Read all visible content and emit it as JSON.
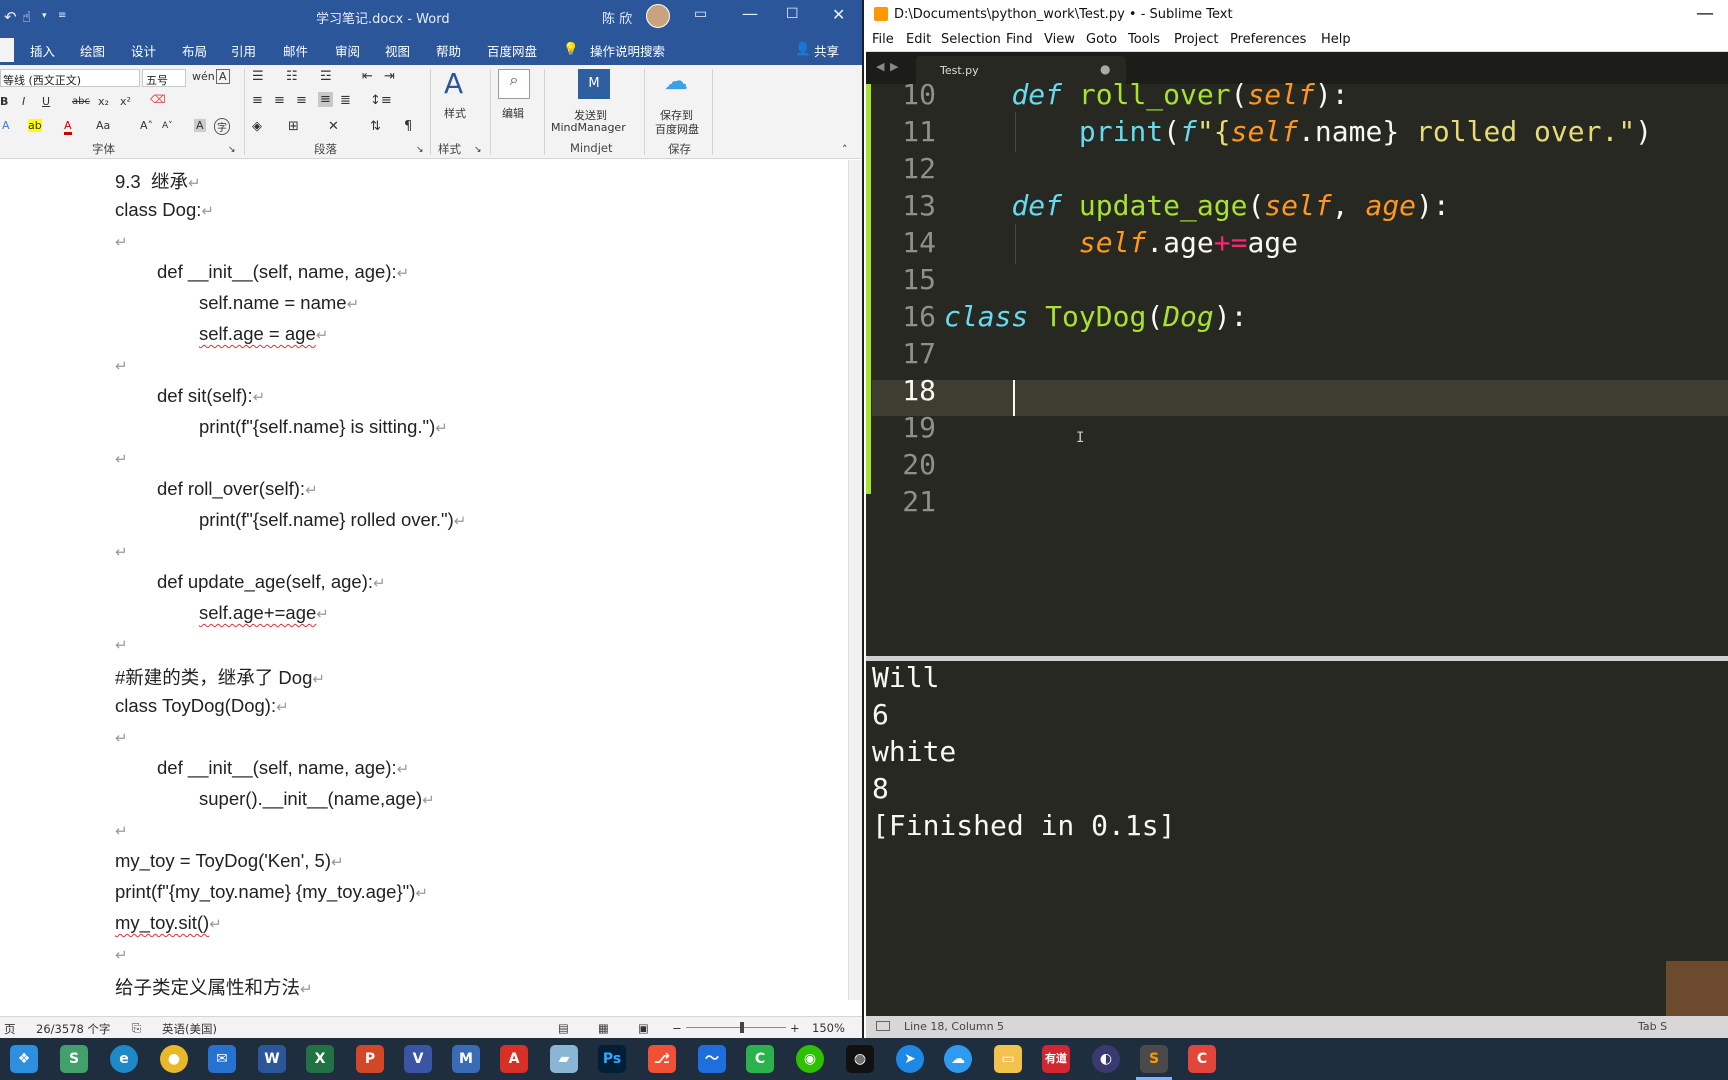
{
  "word": {
    "title_file": "学习笔记.docx",
    "title_app": "Word",
    "user_name": "陈 欣",
    "tabs": [
      "插入",
      "绘图",
      "设计",
      "布局",
      "引用",
      "邮件",
      "审阅",
      "视图",
      "帮助",
      "百度网盘",
      "操作说明搜索"
    ],
    "share_label": "共享",
    "font_name": "等线 (西文正文)",
    "font_size": "五号",
    "groups": {
      "font": "字体",
      "paragraph": "段落",
      "styles": "样式",
      "mindjet": "Mindjet",
      "save": "保存"
    },
    "buttons": {
      "styles": "样式",
      "edit": "编辑",
      "send_to_1": "发送到",
      "send_to_2": "MindManager",
      "save_to_1": "保存到",
      "save_to_2": "百度网盘"
    },
    "doc_lines": [
      "9.3  继承",
      "class Dog:",
      "",
      "def __init__(self, name, age):",
      "self.name = name",
      "self.age = age",
      "",
      "def sit(self):",
      "print(f\"{self.name} is sitting.\")",
      "",
      "def roll_over(self):",
      "print(f\"{self.name} rolled over.\")",
      "",
      "def update_age(self, age):",
      "self.age+=age",
      "",
      "#新建的类，继承了 Dog",
      "class ToyDog(Dog):",
      "",
      "def __init__(self, name, age):",
      "super().__init__(name,age)",
      "",
      "my_toy = ToyDog('Ken', 5)",
      "print(f\"{my_toy.name} {my_toy.age}\")",
      "my_toy.sit()",
      "",
      "给子类定义属性和方法"
    ],
    "status": {
      "page": "页",
      "words": "26/3578 个字",
      "lang": "英语(美国)",
      "zoom": "150%"
    }
  },
  "sublime": {
    "title": "D:\\Documents\\python_work\\Test.py • - Sublime Text",
    "menu": [
      "File",
      "Edit",
      "Selection",
      "Find",
      "View",
      "Goto",
      "Tools",
      "Project",
      "Preferences",
      "Help"
    ],
    "tab_name": "Test.py",
    "tab_dirty": "●",
    "line_numbers": [
      "10",
      "11",
      "12",
      "13",
      "14",
      "15",
      "16",
      "17",
      "18",
      "19",
      "20",
      "21"
    ],
    "code": {
      "l10": {
        "kw": "def",
        "fn": "roll_over",
        "p1": "(",
        "self": "self",
        "p2": "):"
      },
      "l11": {
        "fn": "print",
        "p1": "(",
        "f": "f",
        "str_a": "\"{",
        "self": "self",
        "mid": ".name}",
        "str_b": " rolled over.\"",
        "p2": ")"
      },
      "l13": {
        "kw": "def",
        "fn": "update_age",
        "p1": "(",
        "self": "self",
        "comma": ", ",
        "arg": "age",
        "p2": "):"
      },
      "l14": {
        "self": "self",
        "mid": ".age",
        "op": "+=",
        "rest": "age"
      },
      "l16": {
        "kw": "class",
        "cls": "ToyDog",
        "p1": "(",
        "base": "Dog",
        "p2": "):"
      }
    },
    "output": [
      "Will",
      "6",
      "white",
      "8",
      "[Finished in 0.1s]"
    ],
    "status_text": "Line 18, Column 5",
    "status_right": "Tab S"
  },
  "taskbar": {
    "apps": [
      "windows-start",
      "sublime-snake",
      "edge",
      "chrome",
      "mail",
      "word",
      "excel",
      "powerpoint",
      "visio",
      "mindjet",
      "acrobat",
      "notepad",
      "photoshop",
      "git",
      "tencent-meeting",
      "camtasia",
      "wechat",
      "qq",
      "feishu",
      "baidu-netdisk",
      "file-explorer",
      "youdao",
      "eclipse",
      "sublime",
      "camtasia-recorder"
    ],
    "labels": {
      "word": "W",
      "excel": "X",
      "powerpoint": "P",
      "photoshop": "Ps",
      "youdao": "有道"
    }
  }
}
